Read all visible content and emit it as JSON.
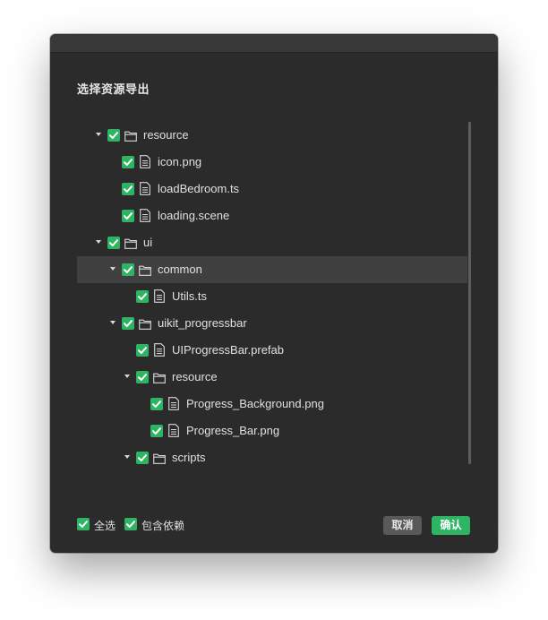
{
  "dialog": {
    "title": "选择资源导出",
    "accent_color": "#2fb463"
  },
  "tree": [
    {
      "label": "resource",
      "type": "folder",
      "depth": 0,
      "expanded": true,
      "checked": true
    },
    {
      "label": "icon.png",
      "type": "file",
      "depth": 1,
      "checked": true
    },
    {
      "label": "loadBedroom.ts",
      "type": "file",
      "depth": 1,
      "checked": true
    },
    {
      "label": "loading.scene",
      "type": "file",
      "depth": 1,
      "checked": true
    },
    {
      "label": "ui",
      "type": "folder",
      "depth": 0,
      "expanded": true,
      "checked": true
    },
    {
      "label": "common",
      "type": "folder",
      "depth": 1,
      "expanded": true,
      "checked": true,
      "highlighted": true
    },
    {
      "label": "Utils.ts",
      "type": "file",
      "depth": 2,
      "checked": true
    },
    {
      "label": "uikit_progressbar",
      "type": "folder",
      "depth": 1,
      "expanded": true,
      "checked": true
    },
    {
      "label": "UIProgressBar.prefab",
      "type": "file",
      "depth": 2,
      "checked": true
    },
    {
      "label": "resource",
      "type": "folder",
      "depth": 2,
      "expanded": true,
      "checked": true
    },
    {
      "label": "Progress_Background.png",
      "type": "file",
      "depth": 3,
      "checked": true
    },
    {
      "label": "Progress_Bar.png",
      "type": "file",
      "depth": 3,
      "checked": true
    },
    {
      "label": "scripts",
      "type": "folder",
      "depth": 2,
      "expanded": true,
      "checked": true
    }
  ],
  "footer": {
    "select_all_label": "全选",
    "select_all_checked": true,
    "include_deps_label": "包含依赖",
    "include_deps_checked": true,
    "cancel_label": "取消",
    "confirm_label": "确认"
  }
}
